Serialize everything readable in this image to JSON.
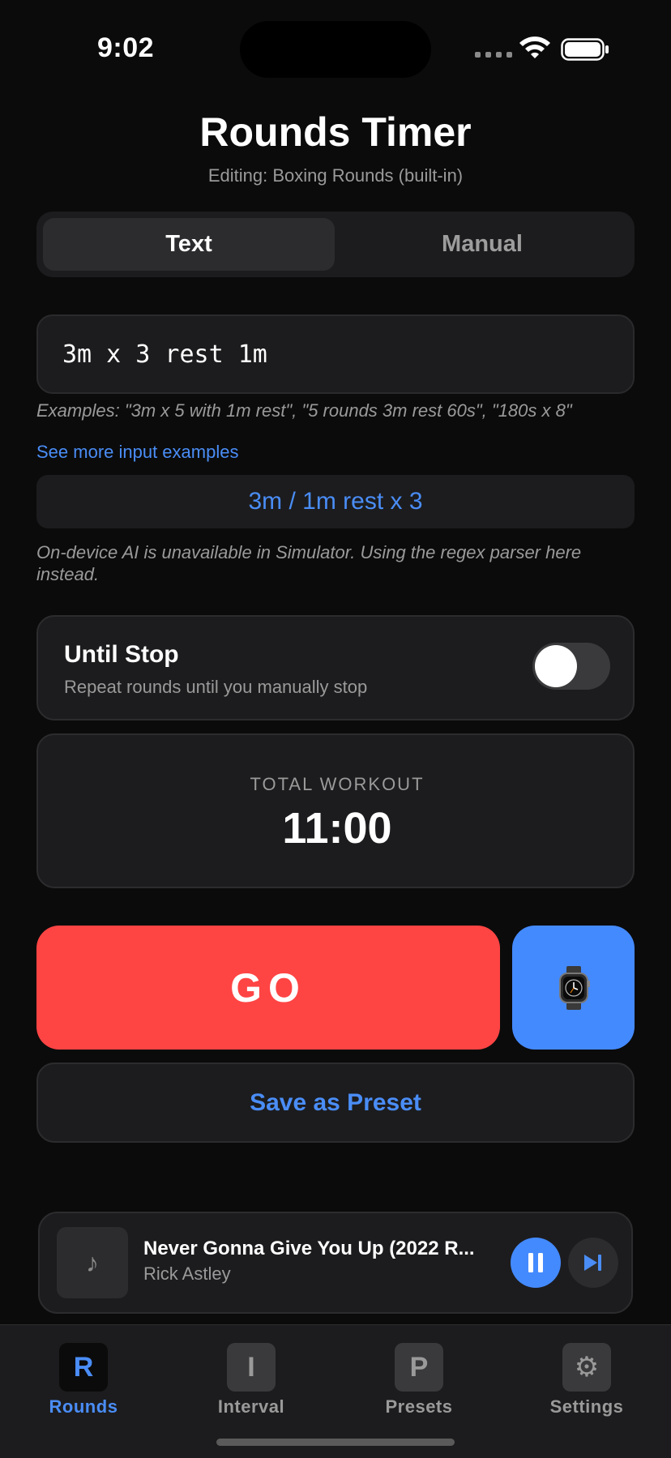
{
  "status_bar": {
    "time": "9:02"
  },
  "header": {
    "title": "Rounds Timer",
    "subtitle": "Editing: Boxing Rounds (built-in)"
  },
  "mode_segment": {
    "options": [
      "Text",
      "Manual"
    ],
    "selected": "Text"
  },
  "text_input": {
    "value": "3m x 3 rest 1m"
  },
  "examples_hint": "Examples: \"3m x 5 with 1m rest\", \"5 rounds 3m rest 60s\", \"180s x 8\"",
  "more_examples_link": "See more input examples",
  "parsed_result": "3m / 1m rest x 3",
  "ai_note": "On-device AI is unavailable in Simulator. Using the regex parser here instead.",
  "until_stop": {
    "title": "Until Stop",
    "subtitle": "Repeat rounds until you manually stop",
    "enabled": false
  },
  "total_workout": {
    "label": "TOTAL WORKOUT",
    "value": "11:00"
  },
  "go_button": "GO",
  "watch_button_icon": "watch-icon",
  "save_preset_button": "Save as Preset",
  "now_playing": {
    "title": "Never Gonna Give You Up (2022 R...",
    "artist": "Rick Astley",
    "artwork_icon": "♪"
  },
  "tabs": [
    {
      "icon": "R",
      "label": "Rounds",
      "active": true
    },
    {
      "icon": "I",
      "label": "Interval",
      "active": false
    },
    {
      "icon": "P",
      "label": "Presets",
      "active": false
    },
    {
      "icon": "⚙",
      "label": "Settings",
      "active": false
    }
  ],
  "colors": {
    "accent_blue": "#4a8df6",
    "go_red": "#ff4444",
    "watch_blue": "#448aff",
    "background": "#0b0b0b",
    "card": "#1c1c1e"
  }
}
